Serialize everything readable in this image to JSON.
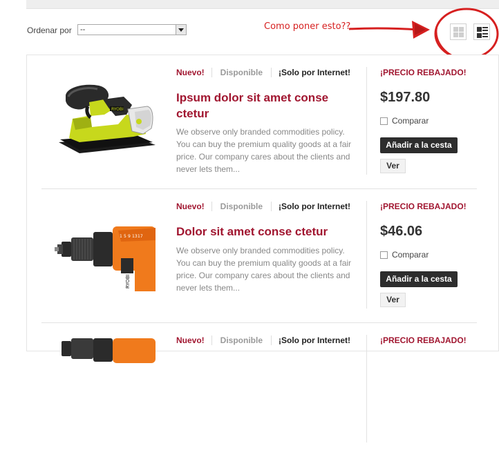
{
  "toolbar": {
    "sort_label": "Ordenar por",
    "sort_value": "--"
  },
  "annotation": {
    "text": "Como poner esto??",
    "color": "#d62020"
  },
  "view_toggle": {
    "grid_icon": "grid-view-icon",
    "list_icon": "list-view-icon",
    "active": "list"
  },
  "colors": {
    "brand": "#a11630",
    "button_dark": "#2d2d2d"
  },
  "products": [
    {
      "flag_new": "Nuevo!",
      "flag_available": "Disponible",
      "flag_online": "¡Solo por Internet!",
      "title": "Ipsum dolor sit amet conse ctetur",
      "description": "We observe only branded commodities policy. You can buy the premium quality goods at a fair price. Our company cares about the clients and never lets them...",
      "price_label": "¡PRECIO REBAJADO!",
      "price": "$197.80",
      "compare_label": "Comparar",
      "cart_label": "Añadir a la cesta",
      "view_label": "Ver",
      "image": "orbital-sander"
    },
    {
      "flag_new": "Nuevo!",
      "flag_available": "Disponible",
      "flag_online": "¡Solo por Internet!",
      "title": "Dolor sit amet conse ctetur",
      "description": "We observe only branded commodities policy. You can buy the premium quality goods at a fair price. Our company cares about the clients and never lets them...",
      "price_label": "¡PRECIO REBAJADO!",
      "price": "$46.06",
      "compare_label": "Comparar",
      "cart_label": "Añadir a la cesta",
      "view_label": "Ver",
      "image": "cordless-drill"
    },
    {
      "flag_new": "Nuevo!",
      "flag_available": "Disponible",
      "flag_online": "¡Solo por Internet!",
      "price_label": "¡PRECIO REBAJADO!",
      "image": "cordless-drill"
    }
  ]
}
